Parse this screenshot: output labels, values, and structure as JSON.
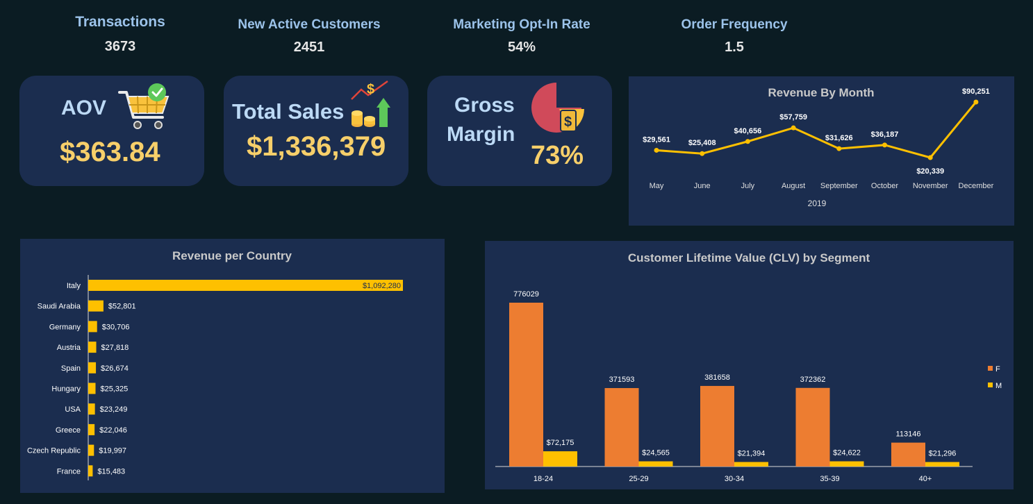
{
  "kpis": [
    {
      "label": "Transactions",
      "value": "3673"
    },
    {
      "label": "New Active Customers",
      "value": "2451"
    },
    {
      "label": "Marketing Opt-In Rate",
      "value": "54%"
    },
    {
      "label": "Order Frequency",
      "value": "1.5"
    }
  ],
  "cards": {
    "aov": {
      "title": "AOV",
      "value": "$363.84",
      "icon": "shopping-cart-check-icon"
    },
    "sales": {
      "title": "Total Sales",
      "value": "$1,336,379",
      "icon": "coins-growth-icon"
    },
    "margin": {
      "title_line1": "Gross",
      "title_line2": "Margin",
      "value": "73%",
      "icon": "pie-dollar-icon"
    }
  },
  "colors": {
    "background": "#0b1c23",
    "panel": "#1b2d4f",
    "accent": "#fec000",
    "orange": "#ed7d31",
    "value_yellow": "#f7cf6a"
  },
  "chart_data": [
    {
      "id": "revenue-by-month",
      "type": "line",
      "title": "Revenue By Month",
      "xlabel": "2019",
      "categories": [
        "May",
        "June",
        "July",
        "August",
        "September",
        "October",
        "November",
        "December"
      ],
      "values": [
        29561,
        25408,
        40656,
        57759,
        31626,
        36187,
        20339,
        90251
      ],
      "labels": [
        "$29,561",
        "$25,408",
        "$40,656",
        "$57,759",
        "$31,626",
        "$36,187",
        "$20,339",
        "$90,251"
      ],
      "color": "#fec000"
    },
    {
      "id": "revenue-per-country",
      "type": "bar",
      "orientation": "horizontal",
      "title": "Revenue per Country",
      "categories": [
        "Italy",
        "Saudi Arabia",
        "Germany",
        "Austria",
        "Spain",
        "Hungary",
        "USA",
        "Greece",
        "Czech Republic",
        "France"
      ],
      "values": [
        1092280,
        52801,
        30706,
        27818,
        26674,
        25325,
        23249,
        22046,
        19997,
        15483
      ],
      "labels": [
        "$1,092,280",
        "$52,801",
        "$30,706",
        "$27,818",
        "$26,674",
        "$25,325",
        "$23,249",
        "$22,046",
        "$19,997",
        "$15,483"
      ],
      "color": "#fec000"
    },
    {
      "id": "clv-by-segment",
      "type": "bar",
      "title": "Customer Lifetime Value (CLV) by Segment",
      "categories": [
        "18-24",
        "25-29",
        "30-34",
        "35-39",
        "40+"
      ],
      "series": [
        {
          "name": "F",
          "color": "#ed7d31",
          "values": [
            776029,
            371593,
            381658,
            372362,
            113146
          ],
          "labels": [
            "776029",
            "371593",
            "381658",
            "372362",
            "113146"
          ]
        },
        {
          "name": "M",
          "color": "#fec000",
          "values": [
            72175,
            24565,
            21394,
            24622,
            21296
          ],
          "labels": [
            "$72,175",
            "$24,565",
            "$21,394",
            "$24,622",
            "$21,296"
          ]
        }
      ],
      "legend": "right"
    }
  ]
}
